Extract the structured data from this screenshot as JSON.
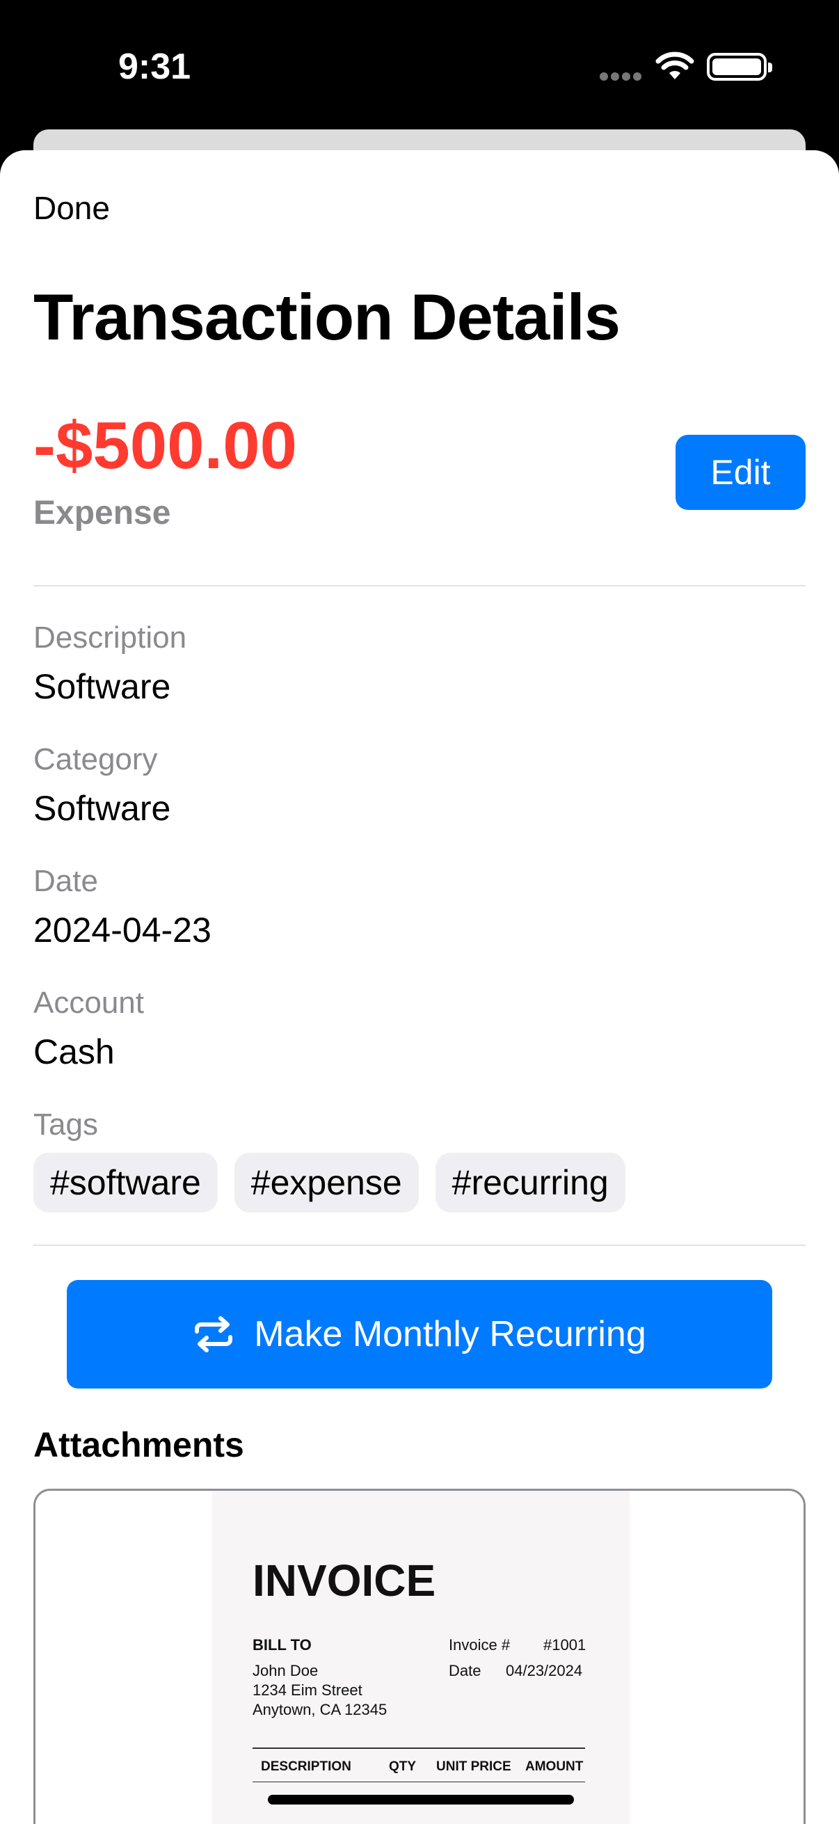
{
  "status_bar": {
    "time": "9:31"
  },
  "nav": {
    "done_label": "Done"
  },
  "page": {
    "title": "Transaction Details"
  },
  "summary": {
    "amount": "-$500.00",
    "type": "Expense",
    "edit_label": "Edit",
    "amount_color": "#ff3b30"
  },
  "fields": {
    "description": {
      "label": "Description",
      "value": "Software"
    },
    "category": {
      "label": "Category",
      "value": "Software"
    },
    "date": {
      "label": "Date",
      "value": "2024-04-23"
    },
    "account": {
      "label": "Account",
      "value": "Cash"
    },
    "tags": {
      "label": "Tags",
      "items": [
        "#software",
        "#expense",
        "#recurring"
      ]
    }
  },
  "actions": {
    "recurring_label": "Make Monthly Recurring",
    "recurring_icon": "repeat-icon",
    "accent_color": "#007aff"
  },
  "attachments": {
    "title": "Attachments",
    "invoice": {
      "title": "INVOICE",
      "bill_to_label": "BILL TO",
      "bill_to_name": "John Doe",
      "bill_to_street": "1234 Eim Street",
      "bill_to_city": "Anytown, CA 12345",
      "invoice_no_label": "Invoice #",
      "invoice_no": "#1001",
      "date_label": "Date",
      "date": "04/23/2024",
      "columns": [
        "DESCRIPTION",
        "QTY",
        "UNIT PRICE",
        "AMOUNT"
      ]
    }
  }
}
